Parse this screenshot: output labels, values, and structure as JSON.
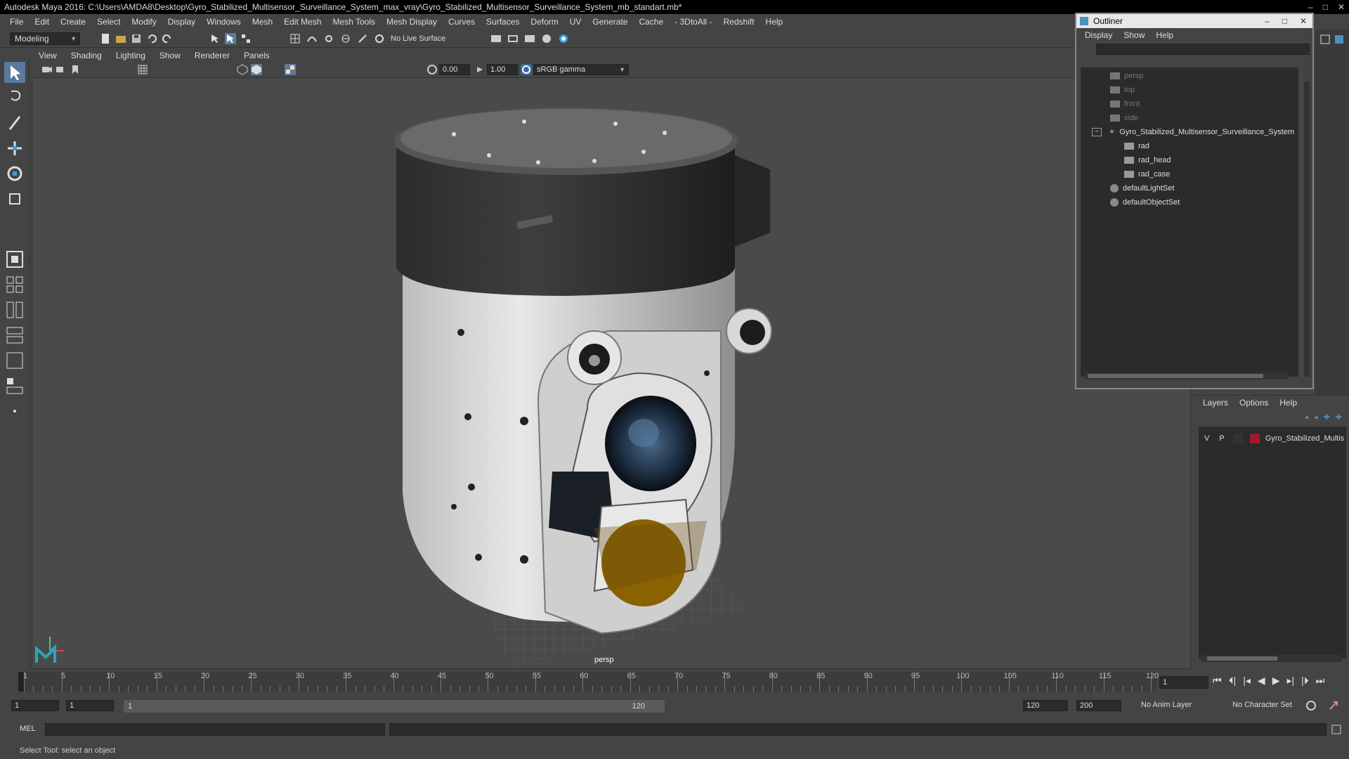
{
  "window": {
    "title": "Autodesk Maya 2016: C:\\Users\\AMDA8\\Desktop\\Gyro_Stabilized_Multisensor_Surveillance_System_max_vray\\Gyro_Stabilized_Multisensor_Surveillance_System_mb_standart.mb*"
  },
  "menubar": [
    "File",
    "Edit",
    "Create",
    "Select",
    "Modify",
    "Display",
    "Windows",
    "Mesh",
    "Edit Mesh",
    "Mesh Tools",
    "Mesh Display",
    "Curves",
    "Surfaces",
    "Deform",
    "UV",
    "Generate",
    "Cache",
    "- 3DtoAll -",
    "Redshift",
    "Help"
  ],
  "shelf": {
    "mode": "Modeling",
    "live_surface": "No Live Surface"
  },
  "panel": {
    "menu": [
      "View",
      "Shading",
      "Lighting",
      "Show",
      "Renderer",
      "Panels"
    ],
    "exposure": "0.00",
    "gamma": "1.00",
    "colorspace": "sRGB gamma",
    "camera_label": "persp"
  },
  "outliner": {
    "title": "Outliner",
    "menu": [
      "Display",
      "Show",
      "Help"
    ],
    "items": [
      {
        "label": "persp",
        "dim": true
      },
      {
        "label": "top",
        "dim": true
      },
      {
        "label": "front",
        "dim": true
      },
      {
        "label": "side",
        "dim": true
      },
      {
        "label": "Gyro_Stabilized_Multisensor_Surveillance_System",
        "dim": false
      },
      {
        "label": "rad",
        "dim": false
      },
      {
        "label": "rad_head",
        "dim": false
      },
      {
        "label": "rad_case",
        "dim": false
      },
      {
        "label": "defaultLightSet",
        "dim": false
      },
      {
        "label": "defaultObjectSet",
        "dim": false
      }
    ]
  },
  "layers": {
    "menu": [
      "Layers",
      "Options",
      "Help"
    ],
    "row": {
      "v": "V",
      "p": "P",
      "name": "Gyro_Stabilized_Multis",
      "color": "#a01830"
    }
  },
  "timeline": {
    "ticks": [
      1,
      5,
      10,
      15,
      20,
      25,
      30,
      35,
      40,
      45,
      50,
      55,
      60,
      65,
      70,
      75,
      80,
      85,
      90,
      95,
      100,
      105,
      110,
      115,
      120
    ],
    "current_frame": "1"
  },
  "range": {
    "start": "1",
    "inner_start": "1",
    "slider_start": "1",
    "slider_end": "120",
    "end": "120",
    "max": "200",
    "anim_layer": "No Anim Layer",
    "character_set": "No Character Set"
  },
  "cmd": {
    "label": "MEL"
  },
  "status": {
    "text": "Select Tool: select an object"
  }
}
